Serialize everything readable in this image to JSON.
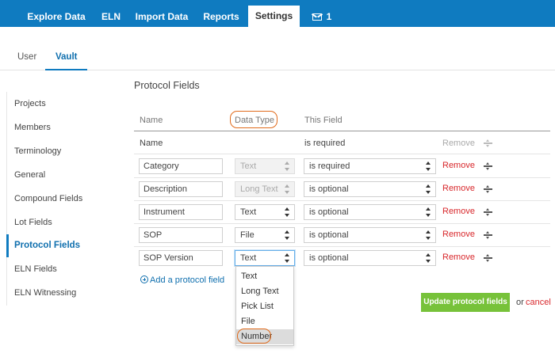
{
  "topnav": {
    "tabs": [
      {
        "label": "Explore Data"
      },
      {
        "label": "ELN"
      },
      {
        "label": "Import Data"
      },
      {
        "label": "Reports"
      },
      {
        "label": "Settings",
        "active": true
      }
    ],
    "messages_count": "1"
  },
  "subtabs": {
    "items": [
      {
        "label": "User"
      },
      {
        "label": "Vault",
        "active": true
      }
    ]
  },
  "sidebar": {
    "items": [
      {
        "label": "Projects"
      },
      {
        "label": "Members"
      },
      {
        "label": "Terminology"
      },
      {
        "label": "General"
      },
      {
        "label": "Compound Fields"
      },
      {
        "label": "Lot Fields"
      },
      {
        "label": "Protocol Fields",
        "active": true
      },
      {
        "label": "ELN Fields"
      },
      {
        "label": "ELN Witnessing"
      }
    ]
  },
  "main": {
    "title": "Protocol Fields",
    "columns": {
      "name": "Name",
      "data_type": "Data Type",
      "this_field": "This Field"
    },
    "fixed_row": {
      "name": "Name",
      "requirement": "is required",
      "remove": "Remove"
    },
    "rows": [
      {
        "name": "Category",
        "data_type": "Text",
        "data_type_disabled": true,
        "requirement": "is required",
        "remove": "Remove"
      },
      {
        "name": "Description",
        "data_type": "Long Text",
        "data_type_disabled": true,
        "requirement": "is optional",
        "remove": "Remove"
      },
      {
        "name": "Instrument",
        "data_type": "Text",
        "data_type_disabled": false,
        "requirement": "is optional",
        "remove": "Remove"
      },
      {
        "name": "SOP",
        "data_type": "File",
        "data_type_disabled": false,
        "requirement": "is optional",
        "remove": "Remove"
      },
      {
        "name": "SOP Version",
        "data_type": "Text",
        "data_type_disabled": false,
        "requirement": "is optional",
        "remove": "Remove",
        "focused": true
      }
    ],
    "dropdown_options": [
      "Text",
      "Long Text",
      "Pick List",
      "File",
      "Number"
    ],
    "dropdown_highlighted": "Number",
    "add_field_label": "Add a protocol field",
    "update_button_label": "Update protocol fields",
    "or_text": "or",
    "cancel_label": "cancel"
  },
  "colors": {
    "nav_blue": "#0f7bc0",
    "remove_red": "#d8282c",
    "update_green": "#77c23a",
    "highlight_orange": "#e06a1b"
  }
}
